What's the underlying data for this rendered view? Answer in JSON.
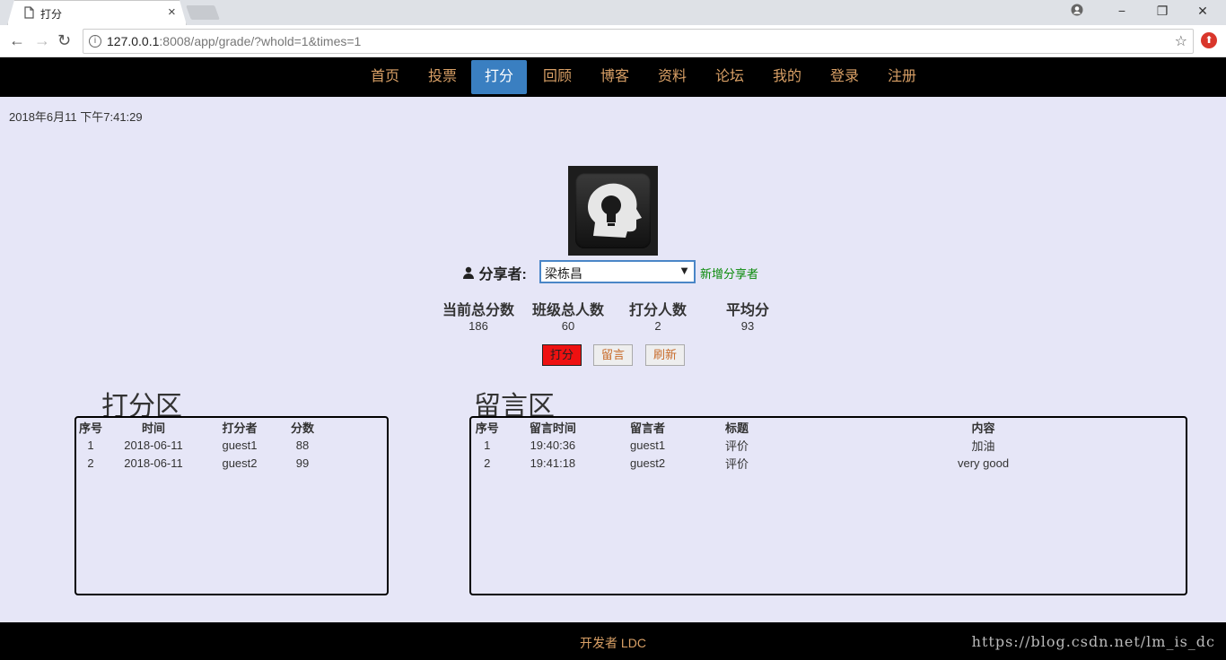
{
  "browser": {
    "tab_title": "打分",
    "url_host": "127.0.0.1",
    "url_rest": ":8008/app/grade/?whold=1&times=1"
  },
  "nav": {
    "items": [
      "首页",
      "投票",
      "打分",
      "回顾",
      "博客",
      "资料",
      "论坛",
      "我的",
      "登录",
      "注册"
    ],
    "active": "打分"
  },
  "datetime": "2018年6月11 下午7:41:29",
  "sharer": {
    "label": "分享者:",
    "selected": "梁栋昌",
    "add_link": "新增分享者"
  },
  "stats": {
    "labels": [
      "当前总分数",
      "班级总人数",
      "打分人数",
      "平均分"
    ],
    "values": [
      "186",
      "60",
      "2",
      "93"
    ]
  },
  "buttons": {
    "score": "打分",
    "comment": "留言",
    "refresh": "刷新"
  },
  "score_area": {
    "title": "打分区",
    "headers": [
      "序号",
      "时间",
      "打分者",
      "分数"
    ],
    "rows": [
      [
        "1",
        "2018-06-11",
        "guest1",
        "88"
      ],
      [
        "2",
        "2018-06-11",
        "guest2",
        "99"
      ]
    ]
  },
  "comment_area": {
    "title": "留言区",
    "headers": [
      "序号",
      "留言时间",
      "留言者",
      "标题",
      "内容"
    ],
    "rows": [
      [
        "1",
        "19:40:36",
        "guest1",
        "评价",
        "加油"
      ],
      [
        "2",
        "19:41:18",
        "guest2",
        "评价",
        "very good"
      ]
    ]
  },
  "footer": {
    "text": "开发者 LDC",
    "watermark": "https://blog.csdn.net/lm_is_dc"
  }
}
